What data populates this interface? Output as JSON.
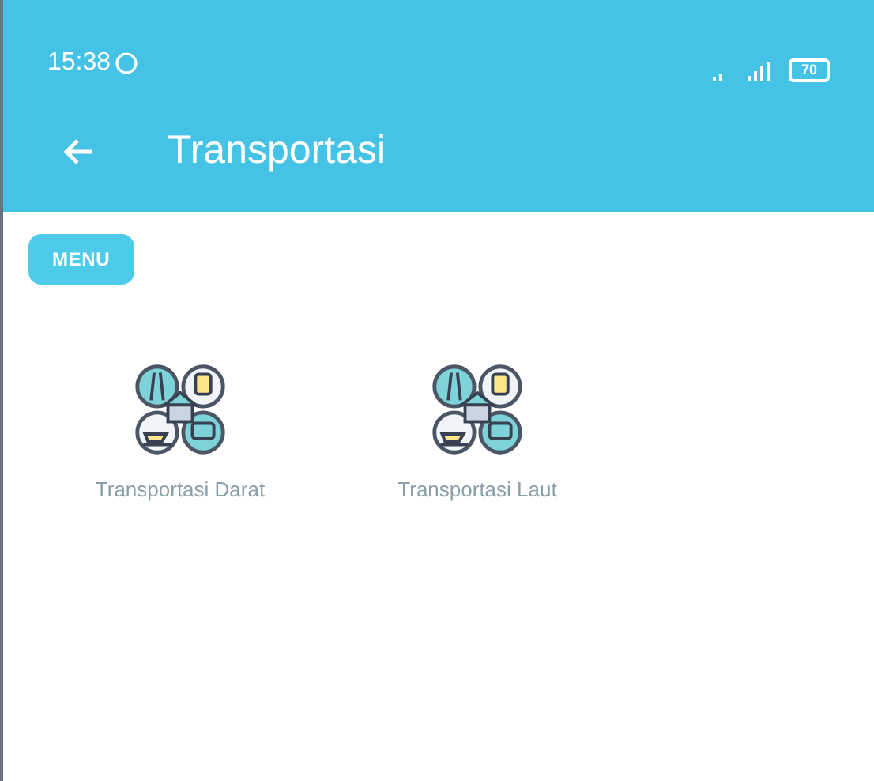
{
  "status_bar": {
    "time": "15:38",
    "battery": "70"
  },
  "app_bar": {
    "title": "Transportasi"
  },
  "menu_chip": {
    "label": "MENU"
  },
  "items": [
    {
      "label": "Transportasi Darat"
    },
    {
      "label": "Transportasi Laut"
    }
  ]
}
